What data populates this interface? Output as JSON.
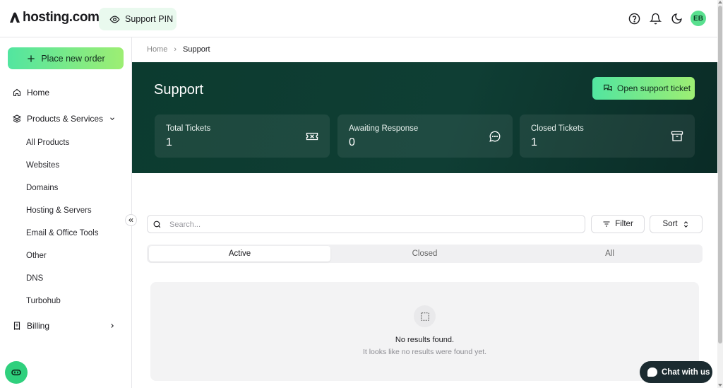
{
  "header": {
    "logo_text": "hosting.com",
    "support_pin_label": "Support PIN",
    "avatar_initials": "EB",
    "accent_color": "#52e5a0"
  },
  "sidebar": {
    "order_button_label": "Place new order",
    "home_label": "Home",
    "products_label": "Products & Services",
    "sub_items": [
      "All Products",
      "Websites",
      "Domains",
      "Hosting & Servers",
      "Email & Office Tools",
      "Other",
      "DNS",
      "Turbohub"
    ],
    "billing_label": "Billing"
  },
  "breadcrumb": {
    "home": "Home",
    "separator": "›",
    "current": "Support"
  },
  "hero": {
    "title": "Support",
    "open_ticket_label": "Open support ticket",
    "background_color": "#0f3e34",
    "stats": [
      {
        "label": "Total Tickets",
        "value": "1",
        "icon": "ticket-icon"
      },
      {
        "label": "Awaiting Response",
        "value": "0",
        "icon": "chat-bubble-icon"
      },
      {
        "label": "Closed Tickets",
        "value": "1",
        "icon": "archive-icon"
      }
    ]
  },
  "toolbar": {
    "search_placeholder": "Search...",
    "filter_label": "Filter",
    "sort_label": "Sort"
  },
  "tabs": {
    "active": "Active",
    "closed": "Closed",
    "all": "All",
    "selected": "Active"
  },
  "empty_state": {
    "title": "No results found.",
    "subtitle": "It looks like no results were found yet."
  },
  "chat": {
    "label": "Chat with us",
    "color": "#1b2b30"
  }
}
